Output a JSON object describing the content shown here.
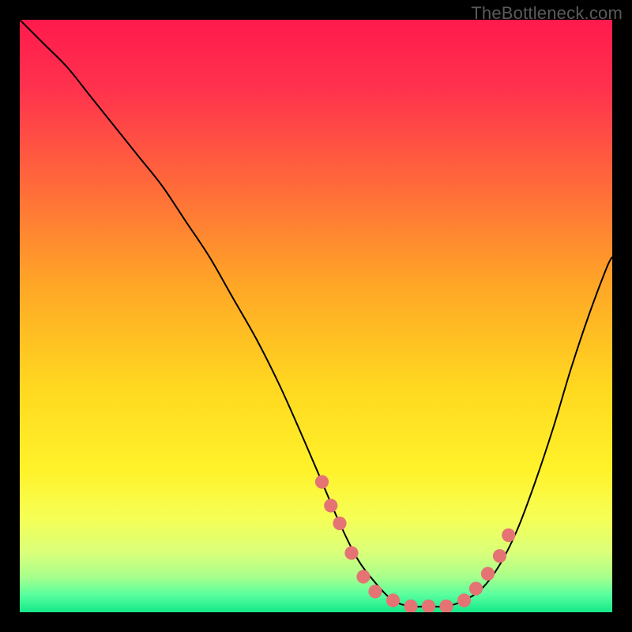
{
  "watermark": "TheBottleneck.com",
  "chart_data": {
    "type": "line",
    "title": "",
    "xlabel": "",
    "ylabel": "",
    "xlim": [
      0,
      100
    ],
    "ylim": [
      0,
      100
    ],
    "grid": false,
    "legend": false,
    "background_gradient": {
      "stops": [
        {
          "offset": 0.0,
          "color": "#ff1a4d"
        },
        {
          "offset": 0.12,
          "color": "#ff334d"
        },
        {
          "offset": 0.28,
          "color": "#ff6a3a"
        },
        {
          "offset": 0.45,
          "color": "#ffa726"
        },
        {
          "offset": 0.62,
          "color": "#ffd820"
        },
        {
          "offset": 0.76,
          "color": "#fff22a"
        },
        {
          "offset": 0.84,
          "color": "#f6ff55"
        },
        {
          "offset": 0.9,
          "color": "#d9ff7a"
        },
        {
          "offset": 0.94,
          "color": "#a8ff8c"
        },
        {
          "offset": 0.97,
          "color": "#5aff9e"
        },
        {
          "offset": 1.0,
          "color": "#14e88a"
        }
      ]
    },
    "series": [
      {
        "name": "bottleneck-curve",
        "type": "line",
        "color": "#000000",
        "x": [
          0,
          4,
          8,
          12,
          16,
          20,
          24,
          28,
          32,
          36,
          40,
          44,
          48,
          51,
          54,
          57,
          60,
          63,
          66,
          69,
          72,
          75,
          78,
          81,
          84,
          87,
          90,
          93,
          96,
          99,
          100
        ],
        "y": [
          100,
          96,
          92,
          87,
          82,
          77,
          72,
          66,
          60,
          53,
          46,
          38,
          29,
          22,
          15,
          9,
          5,
          2,
          1,
          1,
          1,
          2,
          4,
          8,
          14,
          22,
          31,
          41,
          50,
          58,
          60
        ]
      },
      {
        "name": "bottleneck-markers",
        "type": "scatter",
        "color": "#e57373",
        "x": [
          51,
          52.5,
          54,
          56,
          58,
          60,
          63,
          66,
          69,
          72,
          75,
          77,
          79,
          81,
          82.5
        ],
        "y": [
          22,
          18,
          15,
          10,
          6,
          3.5,
          2,
          1,
          1,
          1,
          2,
          4,
          6.5,
          9.5,
          13
        ]
      }
    ]
  }
}
